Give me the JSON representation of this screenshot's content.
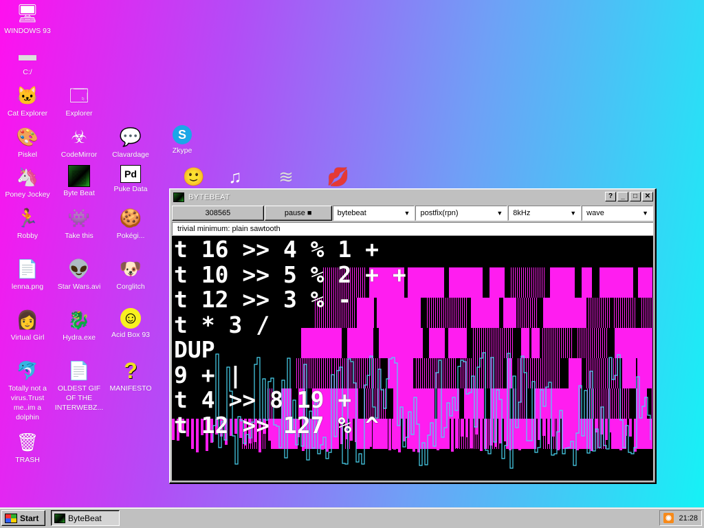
{
  "desktop": {
    "icons": [
      {
        "label": "WINDOWS 93",
        "glyph": "🖥",
        "icon": "computer-icon"
      },
      {
        "label": "C:/",
        "glyph": "▬",
        "icon": "drive-icon"
      },
      {
        "label": "Cat Explorer",
        "glyph": "🐱",
        "icon": "cat-explorer-icon"
      },
      {
        "label": "Explorer",
        "glyph": "🗔",
        "icon": "explorer-icon"
      },
      {
        "label": "Piskel",
        "glyph": "🎨",
        "icon": "palette-icon"
      },
      {
        "label": "CodeMirror",
        "glyph": "☣",
        "icon": "codemirror-icon"
      },
      {
        "label": "Clavardage",
        "glyph": "💬",
        "icon": "chat-icon"
      },
      {
        "label": "Zkype",
        "glyph": "S",
        "icon": "zkype-icon"
      },
      {
        "label": "Poney Jockey",
        "glyph": "🦄",
        "icon": "pony-icon"
      },
      {
        "label": "Byte Beat",
        "glyph": "▩",
        "icon": "bytebeat-icon"
      },
      {
        "label": "Puke Data",
        "glyph": "Pd",
        "icon": "puredata-icon"
      },
      {
        "label": "Robby",
        "glyph": "🏃",
        "icon": "robby-icon"
      },
      {
        "label": "Take this",
        "glyph": "👾",
        "icon": "take-this-icon"
      },
      {
        "label": "Pokégi...",
        "glyph": "🍪",
        "icon": "pokegi-icon"
      },
      {
        "label": "lenna.png",
        "glyph": "📄",
        "icon": "image-file-icon"
      },
      {
        "label": "Star Wars.avi",
        "glyph": "👽",
        "icon": "video-file-icon"
      },
      {
        "label": "Corglitch",
        "glyph": "🐶",
        "icon": "corgi-icon"
      },
      {
        "label": "Virtual Girl",
        "glyph": "👩",
        "icon": "virtual-girl-icon"
      },
      {
        "label": "Hydra.exe",
        "glyph": "🐉",
        "icon": "hydra-icon"
      },
      {
        "label": "Acid Box 93",
        "glyph": "☺",
        "icon": "acid-smiley-icon"
      },
      {
        "label": "Totally not a virus.Trust me..im a dolphin",
        "glyph": "🐬",
        "icon": "dolphin-icon"
      },
      {
        "label": "OLDEST GIF OF THE INTERWEBZ...",
        "glyph": "📄",
        "icon": "gif-file-icon"
      },
      {
        "label": "MANIFESTO",
        "glyph": "?",
        "icon": "question-icon"
      },
      {
        "label": "TRASH",
        "glyph": "🗑",
        "icon": "trash-icon"
      }
    ]
  },
  "window": {
    "title": "BYTEBEAT",
    "help_label": "?",
    "minimize_label": "_",
    "maximize_label": "□",
    "close_label": "✕",
    "counter": "308565",
    "pause_label": "pause ■",
    "mode_select": "bytebeat",
    "notation_select": "postfix(rpn)",
    "rate_select": "8kHz",
    "view_select": "wave",
    "hint": "trivial minimum: plain sawtooth",
    "code_lines": [
      "t 16 >> 4 % 1 +",
      "t 10 >> 5 % 2 + +",
      "t 12 >> 3 % -",
      "t * 3 /",
      "DUP",
      "9 + |",
      "t 4 >> 8 19 +",
      "t 12 >> 127 % ^"
    ]
  },
  "taskbar": {
    "start_label": "Start",
    "task_label": "ByteBeat",
    "clock": "21:28"
  },
  "colors": {
    "gradient_left": "#ff10ef",
    "gradient_right": "#14f3f6",
    "viz_magenta": "#ff1df0",
    "viz_cyan": "#4ad6f2"
  }
}
